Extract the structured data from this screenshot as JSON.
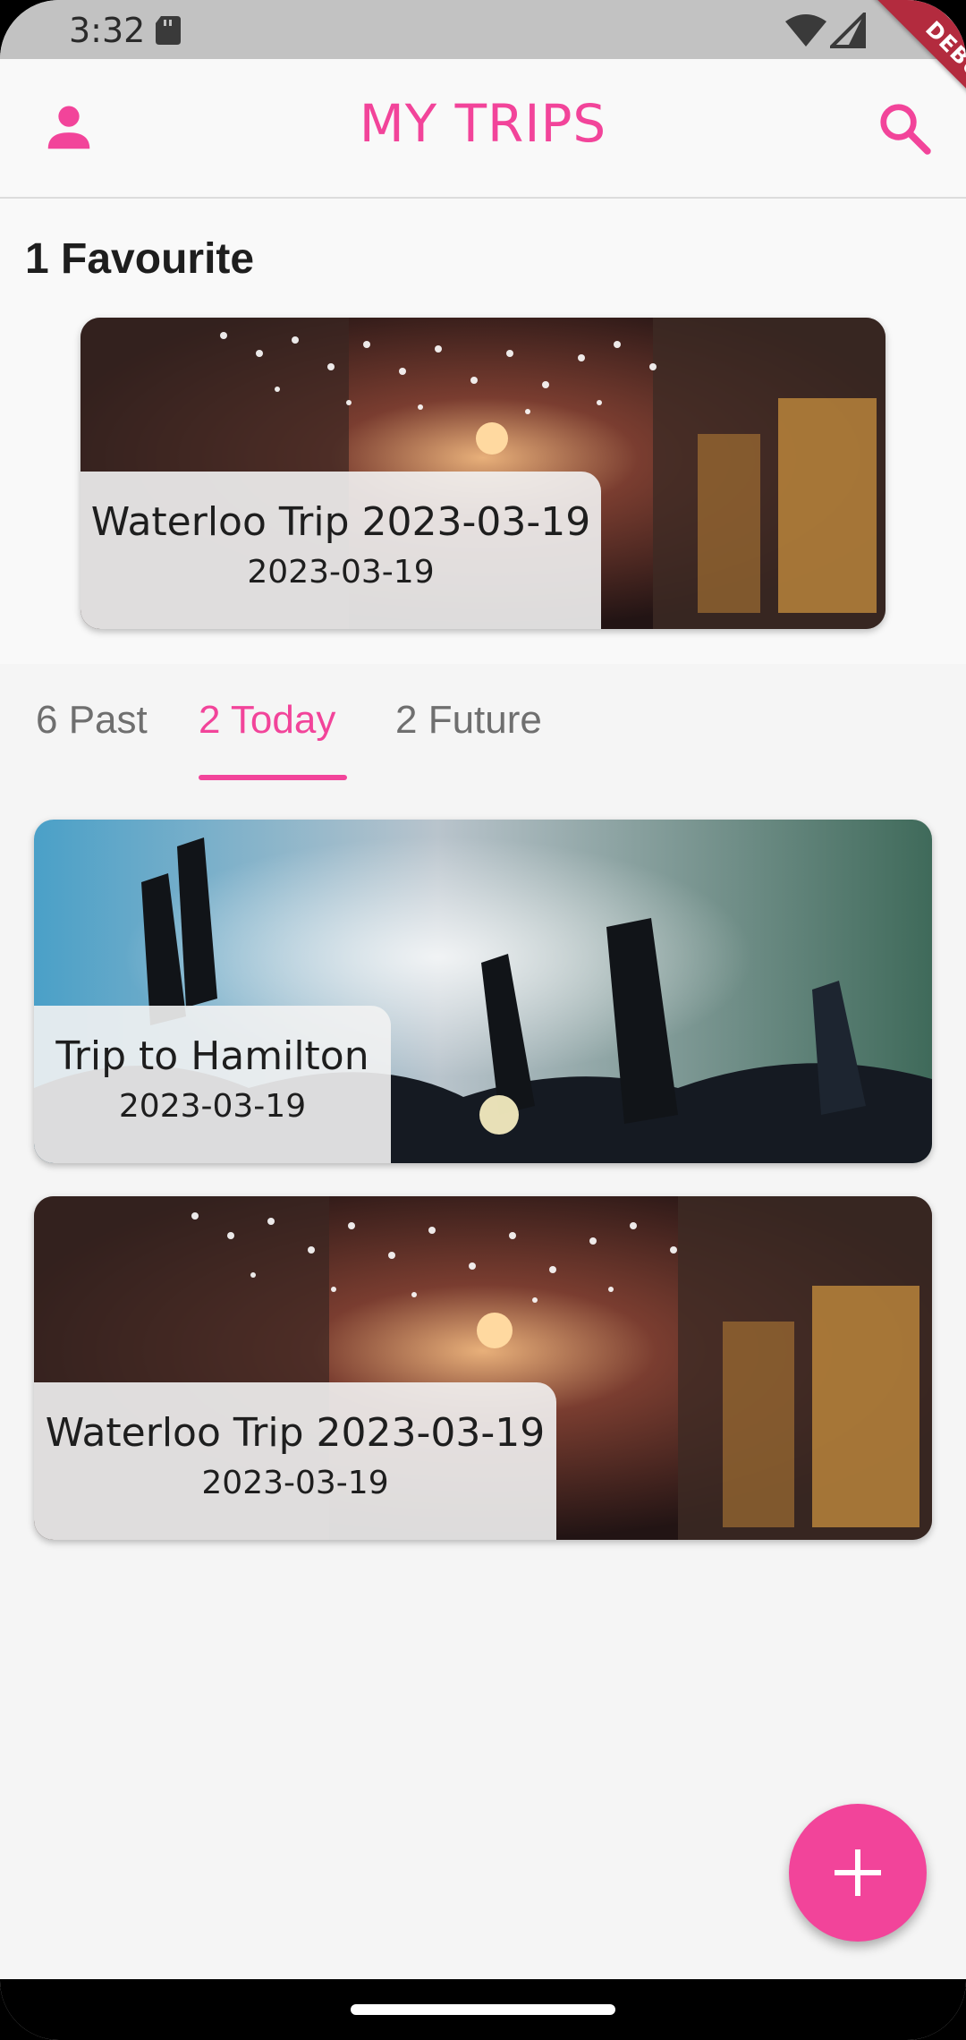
{
  "status_bar": {
    "time": "3:32",
    "debug_label": "DEBUG"
  },
  "app_bar": {
    "title": "MY TRIPS",
    "account_icon": "account-icon",
    "search_icon": "search-icon"
  },
  "favourites": {
    "heading": "1 Favourite",
    "card": {
      "title": "Waterloo Trip 2023-03-19",
      "date": "2023-03-19"
    }
  },
  "tabs": [
    {
      "label": "6 Past",
      "selected": false
    },
    {
      "label": "2 Today",
      "selected": true
    },
    {
      "label": "2 Future",
      "selected": false
    }
  ],
  "trips": [
    {
      "title": "Trip to Hamilton",
      "date": "2023-03-19",
      "image": "concert-crowd"
    },
    {
      "title": "Waterloo Trip 2023-03-19",
      "date": "2023-03-19",
      "image": "street-lights"
    }
  ],
  "fab": {
    "icon": "add-icon"
  },
  "colors": {
    "accent": "#f2449a",
    "background": "#f9f9f9",
    "debug_banner": "#b32b3e"
  }
}
